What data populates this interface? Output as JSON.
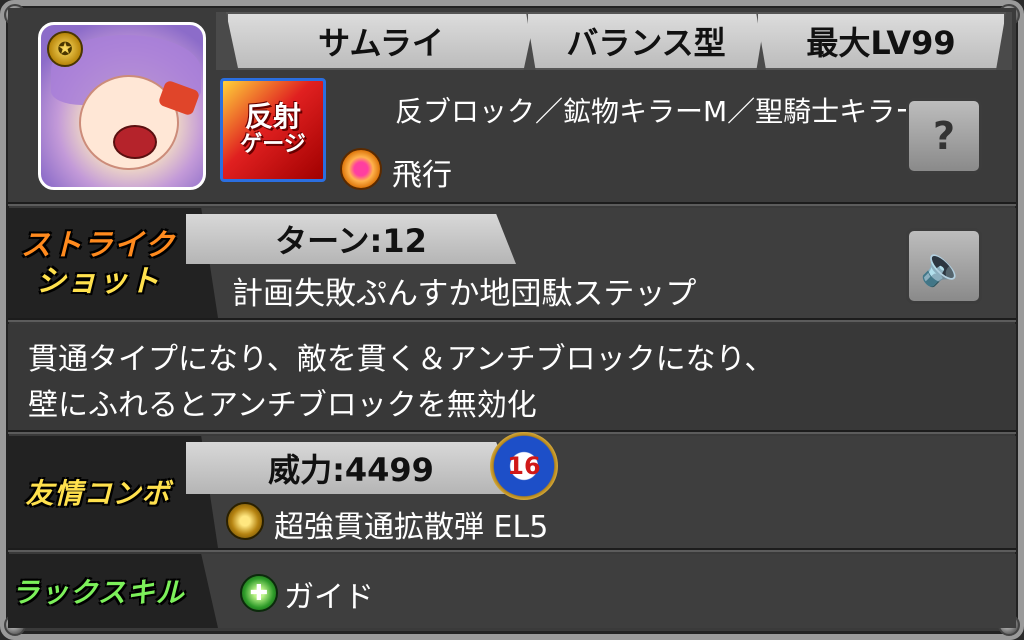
{
  "header": {
    "type": "サムライ",
    "style": "バランス型",
    "max_level": "最大LV99"
  },
  "abilities": {
    "gauge_icon_line1": "反射",
    "gauge_icon_line2": "ゲージ",
    "ability_list": "反ブロック／鉱物キラーM／聖騎士キラー",
    "movement": "飛行"
  },
  "strike_shot": {
    "label_line1": "ストライク",
    "label_line2": "ショット",
    "turns": "ターン:12",
    "name": "計画失敗ぷんすか地団駄ステップ",
    "desc_line1": "貫通タイプになり、敵を貫く＆アンチブロックになり、",
    "desc_line2": "壁にふれるとアンチブロックを無効化"
  },
  "friend_combo": {
    "label": "友情コンボ",
    "power": "威力:4499",
    "count": "16",
    "name": "超強貫通拡散弾 EL5"
  },
  "luck_skill": {
    "label": "ラックスキル",
    "name": "ガイド"
  },
  "buttons": {
    "help": "?",
    "sound": "🔈"
  },
  "colors": {
    "strike_label_top": "#ff8a1e",
    "strike_label_bottom": "#ffe14d",
    "friend_label": "#ffe14d",
    "luck_label": "#7cf05a"
  }
}
